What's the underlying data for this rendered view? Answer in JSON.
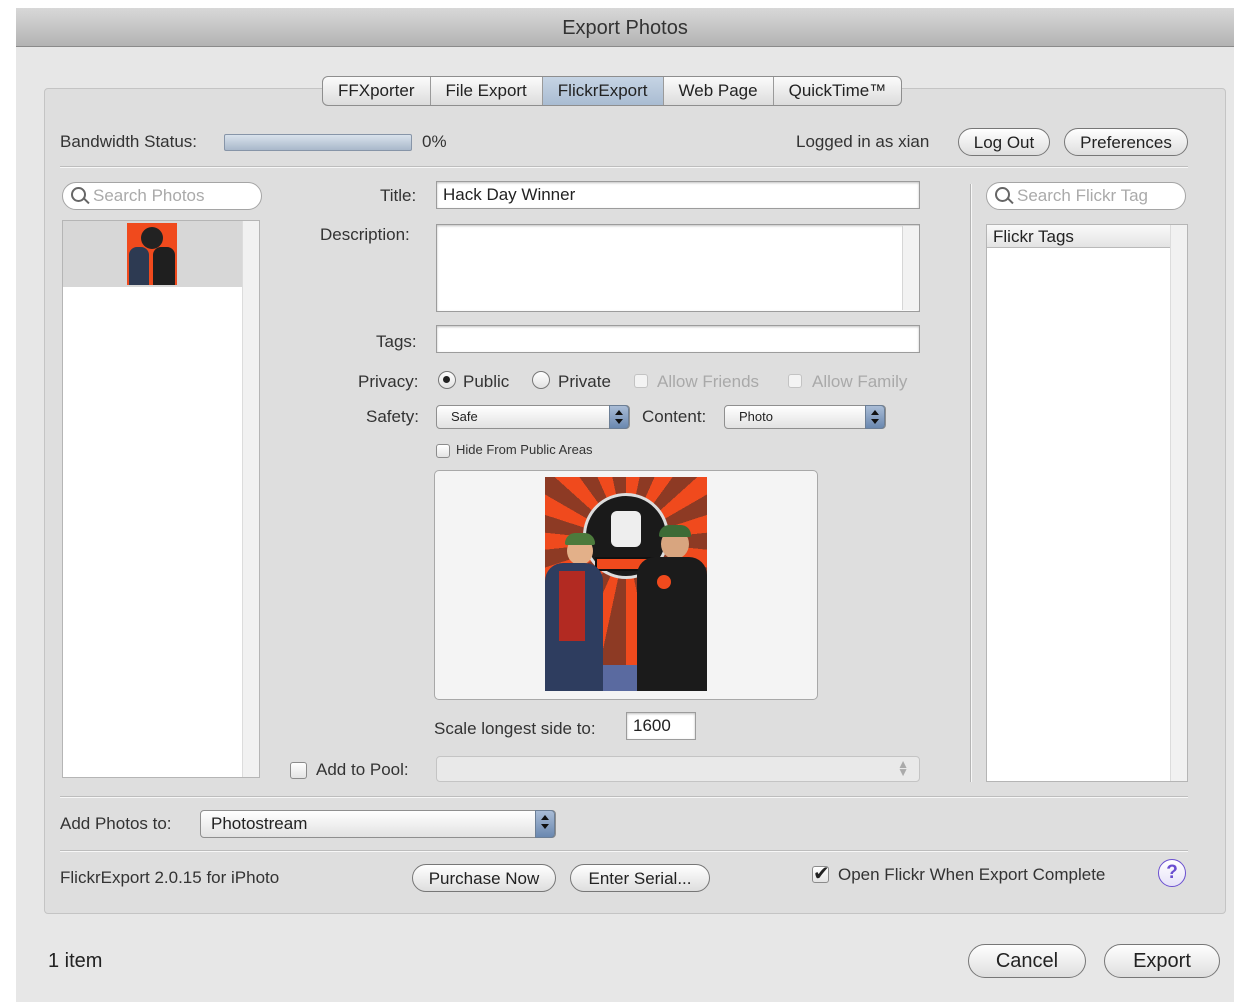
{
  "window": {
    "title": "Export Photos"
  },
  "tabs": [
    {
      "label": "FFXporter",
      "active": false
    },
    {
      "label": "File Export",
      "active": false
    },
    {
      "label": "FlickrExport",
      "active": true
    },
    {
      "label": "Web Page",
      "active": false
    },
    {
      "label": "QuickTime™",
      "active": false
    }
  ],
  "status": {
    "bandwidth_label": "Bandwidth Status:",
    "bandwidth_value": "0%",
    "bandwidth_progress": 0,
    "logged_in": "Logged in as xian",
    "logout_label": "Log Out",
    "preferences_label": "Preferences"
  },
  "left": {
    "search_placeholder": "Search Photos",
    "thumbnail_icon": "photo-thumbnail"
  },
  "form": {
    "title_label": "Title:",
    "title_value": "Hack Day Winner",
    "description_label": "Description:",
    "description_value": "",
    "tags_label": "Tags:",
    "tags_value": "",
    "privacy_label": "Privacy:",
    "privacy_public": "Public",
    "privacy_private": "Private",
    "allow_friends": "Allow Friends",
    "allow_family": "Allow Family",
    "safety_label": "Safety:",
    "safety_value": "Safe",
    "content_label": "Content:",
    "content_value": "Photo",
    "hide_public": "Hide From Public Areas",
    "scale_label": "Scale longest side to:",
    "scale_value": "1600",
    "pool_label": "Add to Pool:",
    "pool_value": ""
  },
  "right": {
    "search_placeholder": "Search Flickr Tag",
    "tags_header": "Flickr Tags"
  },
  "bottom": {
    "add_photos_label": "Add Photos to:",
    "add_photos_value": "Photostream",
    "version": "FlickrExport 2.0.15 for iPhoto",
    "purchase_label": "Purchase Now",
    "serial_label": "Enter Serial...",
    "open_flickr_label": "Open Flickr When Export Complete",
    "open_flickr_checked": true,
    "help_label": "?"
  },
  "footer": {
    "item_count": "1 item",
    "cancel_label": "Cancel",
    "export_label": "Export"
  },
  "colors": {
    "accent_tab": "#b4c5da",
    "popup_arrows": "#7b97bd",
    "help": "#6a4fd0",
    "poster": "#f04a1d"
  }
}
